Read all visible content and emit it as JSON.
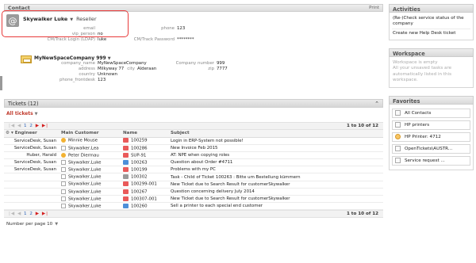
{
  "contact": {
    "section_title": "Contact",
    "print_label": "Print",
    "name": "Skywalker Luke",
    "role": "Reseller",
    "fields": {
      "email_label": "email",
      "email_value": "",
      "phone_label": "phone",
      "phone_value": "123",
      "vip_label": "vip_person",
      "vip_value": "no",
      "login_label": "CM/Track Login (LDAP)",
      "login_value": "luke",
      "password_label": "CM/Track Password",
      "password_value": "********"
    },
    "company": {
      "title": "MyNewSpaceCompany 999",
      "name_label": "company_name",
      "name_value": "MyNewSpaceCompany",
      "number_label": "Company number",
      "number_value": "999",
      "address_label": "address",
      "address_value": "Milkyway 77",
      "city_label": "city",
      "city_value": "Alderaan",
      "zip_label": "zip",
      "zip_value": "7777",
      "country_label": "country",
      "country_value": "Unknown",
      "phone_label": "phone_frontdesk",
      "phone_value": "123"
    }
  },
  "tickets": {
    "title": "Tickets (12)",
    "filter": "All tickets",
    "pager_pages": "1 2",
    "count_text": "1 to 10 of 12",
    "columns": [
      "Engineer",
      "Main Customer",
      "Name",
      "Subject"
    ],
    "rows": [
      {
        "engineer": "ServiceDesk, Susan",
        "customer": "Minnie Mouse",
        "cust_icon": "person",
        "name": "100259",
        "name_icon": "red",
        "subject": "Login in ERP-System not possible!"
      },
      {
        "engineer": "ServiceDesk, Susan",
        "customer": "Skywalker,Lea",
        "cust_icon": "box",
        "name": "100286",
        "name_icon": "red",
        "subject": "New Invoice Feb 2015"
      },
      {
        "engineer": "Huber, Harald",
        "customer": "Peter Diermau",
        "cust_icon": "person",
        "name": "SUP-91",
        "name_icon": "red",
        "subject": "AT: NPE when copying roles"
      },
      {
        "engineer": "ServiceDesk, Susan",
        "customer": "Skywalker,Luke",
        "cust_icon": "box",
        "name": "100263",
        "name_icon": "blue",
        "subject": "Question about Order #4711"
      },
      {
        "engineer": "ServiceDesk, Susan",
        "customer": "Skywalker,Luke",
        "cust_icon": "box",
        "name": "100199",
        "name_icon": "red",
        "subject": "Problems with my PC"
      },
      {
        "engineer": "",
        "customer": "Skywalker,Luke",
        "cust_icon": "box",
        "name": "100302",
        "name_icon": "gray",
        "subject": "Task - Child of Ticket 100263 : Bitte um Bestellung kümmern"
      },
      {
        "engineer": "",
        "customer": "Skywalker,Luke",
        "cust_icon": "box",
        "name": "100299-001",
        "name_icon": "red",
        "subject": "New Ticket due to Search Result for customerSkywalker"
      },
      {
        "engineer": "",
        "customer": "Skywalker,Luke",
        "cust_icon": "box",
        "name": "100267",
        "name_icon": "red",
        "subject": "Question concerning delivery July 2014"
      },
      {
        "engineer": "",
        "customer": "Skywalker,Luke",
        "cust_icon": "box",
        "name": "100307-001",
        "name_icon": "red",
        "subject": "New Ticket due to Search Result for customerSkywalker"
      },
      {
        "engineer": "",
        "customer": "Skywalker,Luke",
        "cust_icon": "box",
        "name": "100260",
        "name_icon": "blue",
        "subject": "Sell a printer to each special end customer"
      }
    ],
    "per_page_label": "Number per page",
    "per_page_value": "10"
  },
  "sidebar": {
    "activities_title": "Activities",
    "activities": [
      "(Re-)Check service status of the company",
      "Create new Help Desk ticket"
    ],
    "workspace_title": "Workspace",
    "workspace_text": "Workspace is empty\nAll your unsaved tasks are automatically listed in this workspace.",
    "favorites_title": "Favorites",
    "favorites": [
      "All Contacts",
      "HP printers",
      "HP Printer: 4712",
      "OpenTickets\\AUSTR...",
      "Service request ..."
    ]
  },
  "colors": {
    "highlight": "#e83b3b",
    "link_red": "#c0392b",
    "pager_blue": "#2a63b8"
  }
}
